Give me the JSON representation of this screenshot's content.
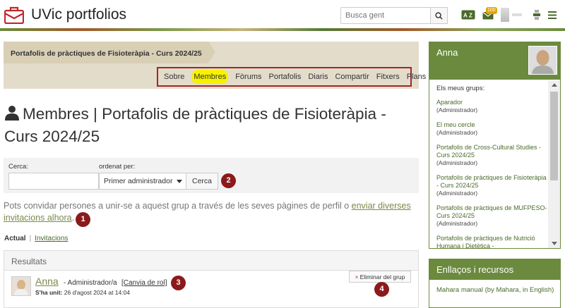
{
  "header": {
    "app_title": "UVic portfolios",
    "search_placeholder": "Busca gent",
    "notification_count": "100",
    "accent": "#a12828"
  },
  "group": {
    "title": "Portafolis de pràctiques de Fisioteràpia - Curs 2024/25",
    "tabs": [
      "Sobre",
      "Membres",
      "Fòrums",
      "Portafolis",
      "Diaris",
      "Compartir",
      "Fitxers",
      "Plans"
    ],
    "active_tab": "Membres"
  },
  "page": {
    "title": "Membres | Portafolis de pràctiques de Fisioteràpia - Curs 2024/25"
  },
  "filter": {
    "search_label": "Cerca:",
    "sort_label": "ordenat per:",
    "sort_value": "Primer administrador",
    "search_button": "Cerca"
  },
  "invite": {
    "text_before": "Pots convidar persones a unir-se a aquest grup a través de les seves pàgines de perfil o ",
    "link_text": "enviar diverses invitacions alhora",
    "text_after": "."
  },
  "subtabs": {
    "current": "Actual",
    "separator": "|",
    "invitations": "Invitacions"
  },
  "results": {
    "heading": "Resultats",
    "member": {
      "name": "Anna",
      "role": "- Administrador/a",
      "change_role": "[Canvia de rol]",
      "joined_label": "S'ha unit:",
      "joined_date": "26 d'agost 2024 at 14:04",
      "remove_button": "Eliminar del grup"
    }
  },
  "annotations": [
    "1",
    "2",
    "3",
    "4"
  ],
  "sidebar": {
    "user_name": "Anna",
    "groups_label": "Els meus grups:",
    "groups": [
      {
        "name": "Aparador",
        "role": "(Administrador)"
      },
      {
        "name": "El meu cercle",
        "role": "(Administrador)"
      },
      {
        "name": "Portafolis de Cross-Cultural Studies - Curs 2024/25",
        "role": "(Administrador)"
      },
      {
        "name": "Portafolis de pràctiques de Fisioteràpia - Curs 2024/25",
        "role": "(Administrador)"
      },
      {
        "name": "Portafolis de pràctiques de MUFPESO- Curs 2024/25",
        "role": "(Administrador)"
      },
      {
        "name": "Portafolis de pràctiques de Nutrició Humana i Dietètica -",
        "role": ""
      }
    ],
    "links_heading": "Enllaços i recursos",
    "links": [
      "Mahara manual (by Mahara, in English)"
    ],
    "accent": "#6b8a3e"
  }
}
